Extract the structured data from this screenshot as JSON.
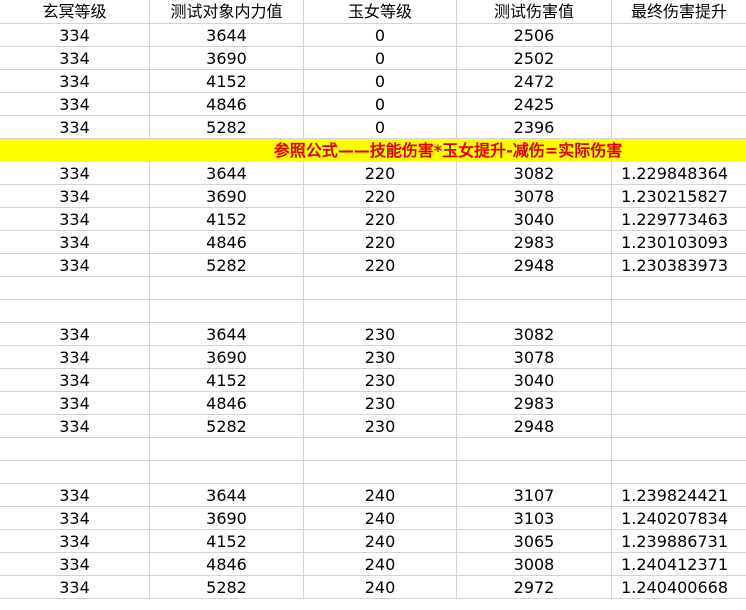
{
  "headers": [
    "玄冥等级",
    "测试对象内力值",
    "玉女等级",
    "测试伤害值",
    "最终伤害提升"
  ],
  "block0": [
    [
      "334",
      "3644",
      "0",
      "2506",
      ""
    ],
    [
      "334",
      "3690",
      "0",
      "2502",
      ""
    ],
    [
      "334",
      "4152",
      "0",
      "2472",
      ""
    ],
    [
      "334",
      "4846",
      "0",
      "2425",
      ""
    ],
    [
      "334",
      "5282",
      "0",
      "2396",
      ""
    ]
  ],
  "formula": "参照公式——技能伤害*玉女提升-减伤=实际伤害",
  "block220": [
    [
      "334",
      "3644",
      "220",
      "3082",
      "1.229848364"
    ],
    [
      "334",
      "3690",
      "220",
      "3078",
      "1.230215827"
    ],
    [
      "334",
      "4152",
      "220",
      "3040",
      "1.229773463"
    ],
    [
      "334",
      "4846",
      "220",
      "2983",
      "1.230103093"
    ],
    [
      "334",
      "5282",
      "220",
      "2948",
      "1.230383973"
    ]
  ],
  "block230": [
    [
      "334",
      "3644",
      "230",
      "3082",
      ""
    ],
    [
      "334",
      "3690",
      "230",
      "3078",
      ""
    ],
    [
      "334",
      "4152",
      "230",
      "3040",
      ""
    ],
    [
      "334",
      "4846",
      "230",
      "2983",
      ""
    ],
    [
      "334",
      "5282",
      "230",
      "2948",
      ""
    ]
  ],
  "block240": [
    [
      "334",
      "3644",
      "240",
      "3107",
      "1.239824421"
    ],
    [
      "334",
      "3690",
      "240",
      "3103",
      "1.240207834"
    ],
    [
      "334",
      "4152",
      "240",
      "3065",
      "1.239886731"
    ],
    [
      "334",
      "4846",
      "240",
      "3008",
      "1.240412371"
    ],
    [
      "334",
      "5282",
      "240",
      "2972",
      "1.240400668"
    ]
  ]
}
